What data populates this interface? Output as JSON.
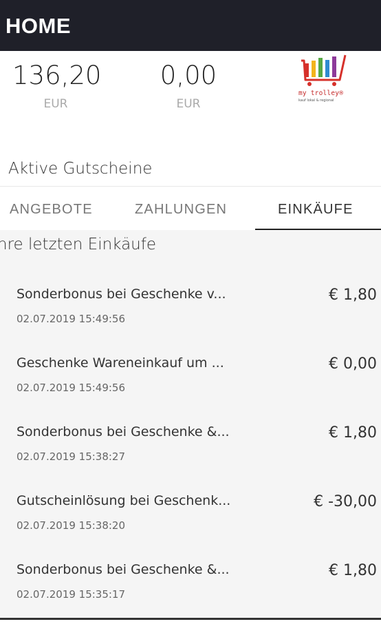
{
  "header": {
    "title": "HOME"
  },
  "balances": [
    {
      "amount": "136,20",
      "currency": "EUR"
    },
    {
      "amount": "0,00",
      "currency": "EUR"
    }
  ],
  "logo": {
    "brand": "my trolley®",
    "tagline": "kauf lokal & regional",
    "bar_colors": [
      "#d6312b",
      "#f2b41c",
      "#56a844",
      "#2f8bd0",
      "#8e3a9a"
    ]
  },
  "vouchers": {
    "title": "Aktive Gutscheine"
  },
  "tabs": [
    {
      "label": "ANGEBOTE",
      "active": false
    },
    {
      "label": "ZAHLUNGEN",
      "active": false
    },
    {
      "label": "EINKÄUFE",
      "active": true
    }
  ],
  "purchases": {
    "title": "hre letzten Einkäufe",
    "items": [
      {
        "name": "Sonderbonus bei Geschenke v...",
        "date": "02.07.2019 15:49:56",
        "amount": "€ 1,80"
      },
      {
        "name": "Geschenke Wareneinkauf um ...",
        "date": "02.07.2019 15:49:56",
        "amount": "€ 0,00"
      },
      {
        "name": "Sonderbonus bei Geschenke &...",
        "date": "02.07.2019 15:38:27",
        "amount": "€ 1,80"
      },
      {
        "name": "Gutscheinlösung bei Geschenk...",
        "date": "02.07.2019 15:38:20",
        "amount": "€ -30,00"
      },
      {
        "name": "Sonderbonus bei Geschenke &...",
        "date": "02.07.2019 15:35:17",
        "amount": "€ 1,80"
      }
    ]
  }
}
